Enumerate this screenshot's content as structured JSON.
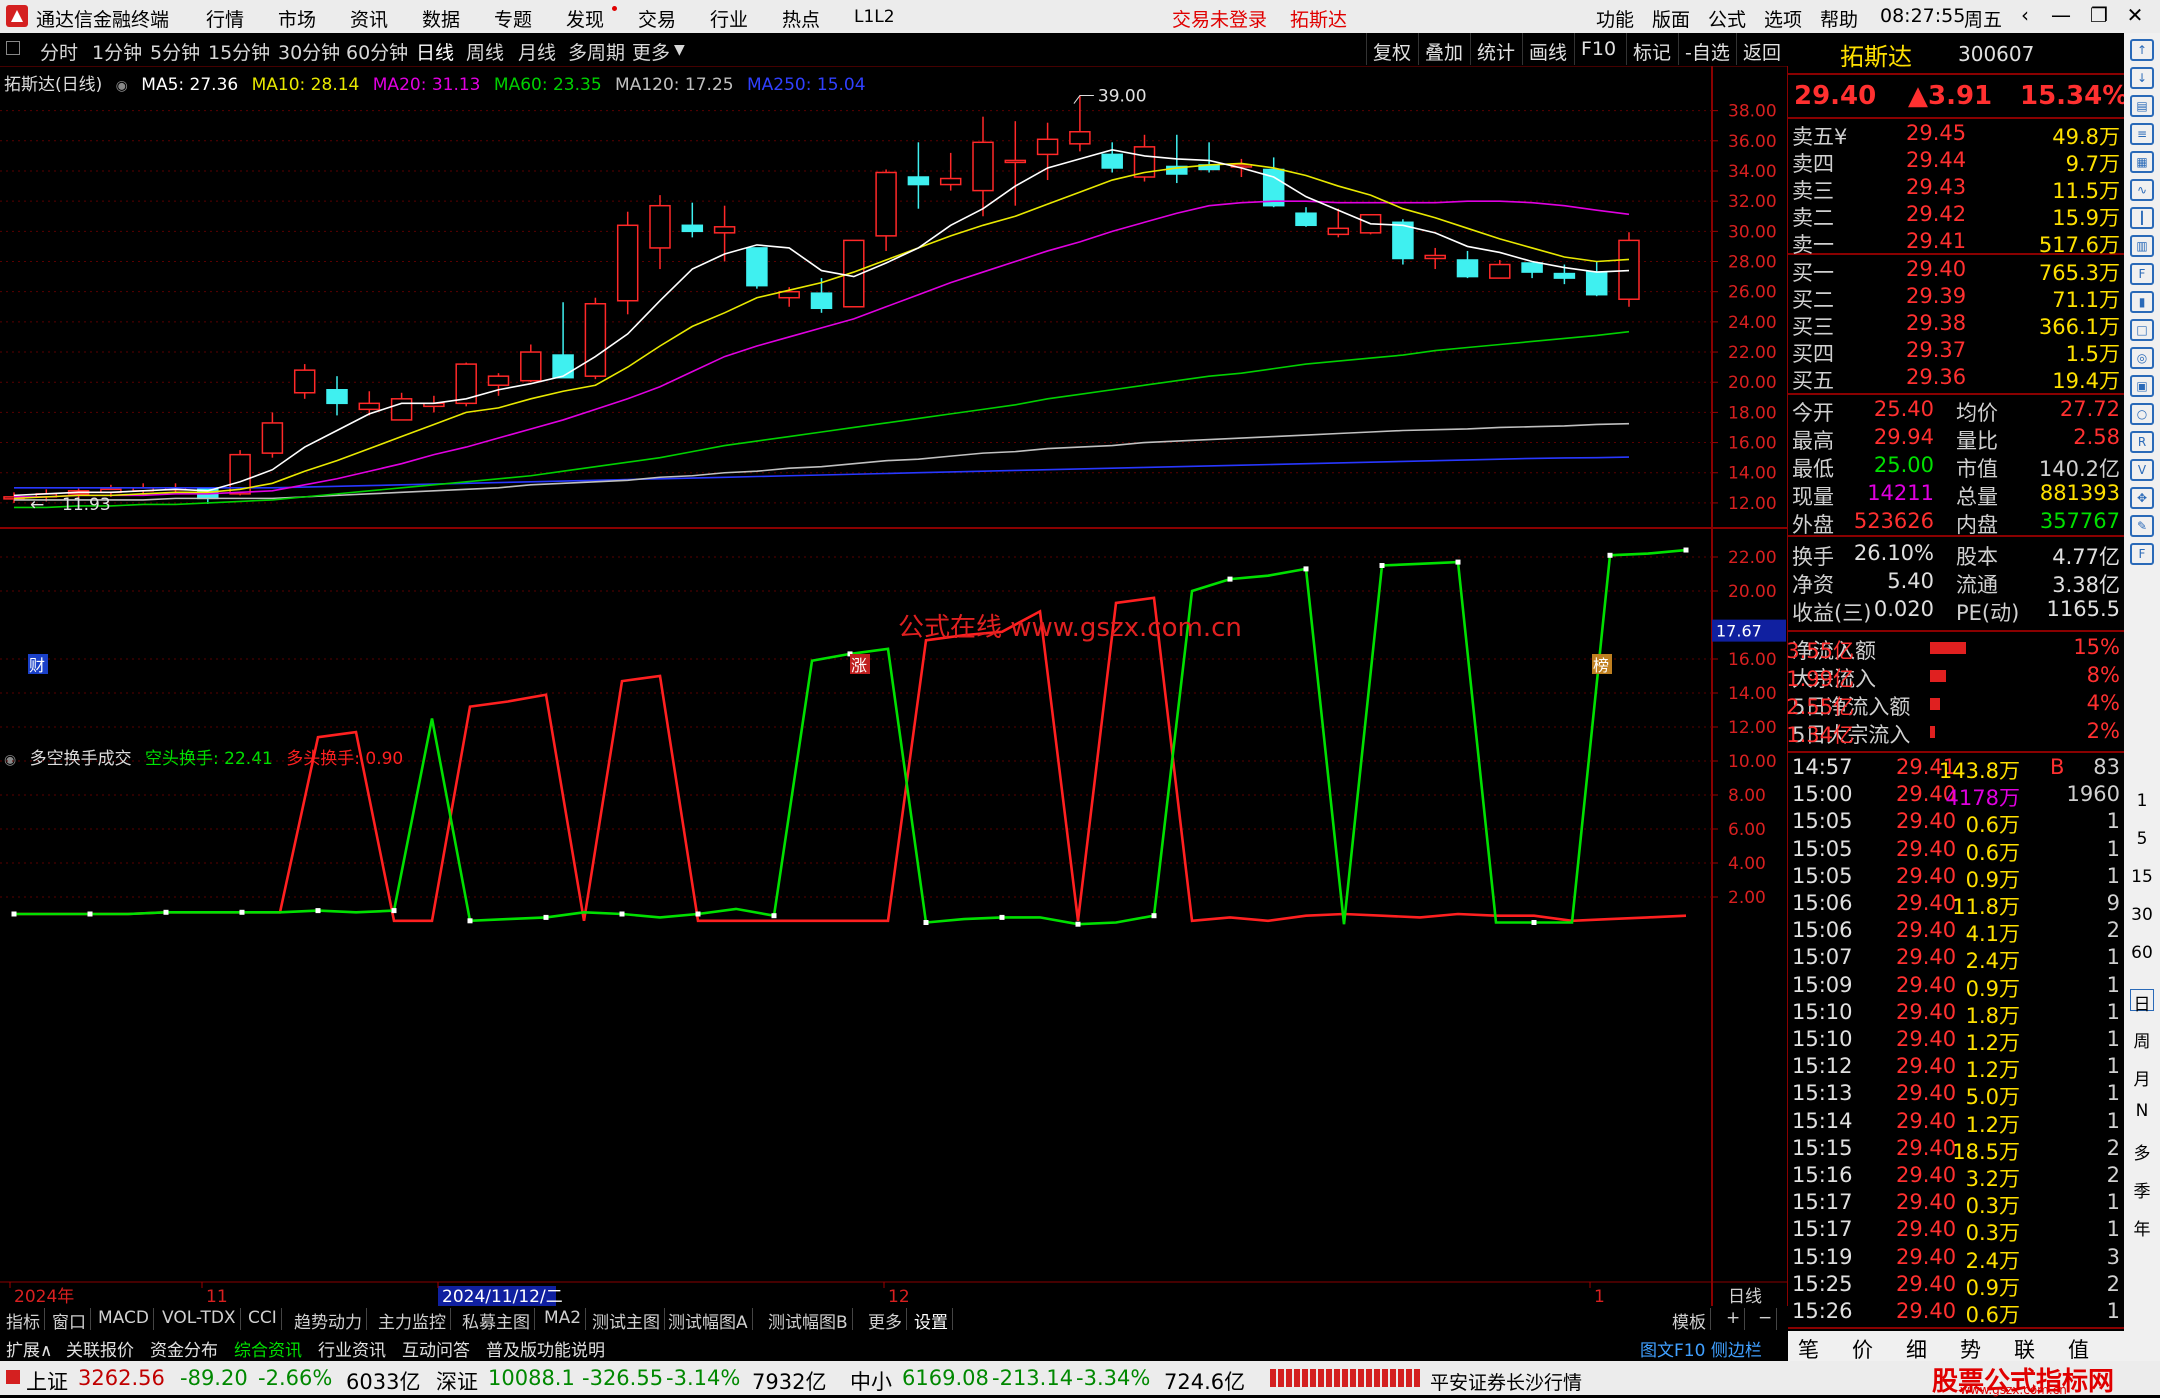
{
  "app": {
    "title": "通达信金融终端",
    "menus": [
      "行情",
      "市场",
      "资讯",
      "数据",
      "专题",
      "发现",
      "交易",
      "行业",
      "热点",
      "L1L2"
    ],
    "notice": "交易未登录",
    "stock_tag": "拓斯达",
    "right_menus": [
      "功能",
      "版面",
      "公式",
      "选项",
      "帮助"
    ],
    "time": "08:27:55",
    "weekday": "周五",
    "win_controls": [
      "‹",
      "—",
      "❐",
      "✕"
    ]
  },
  "toolbar": {
    "periods": [
      "分时",
      "1分钟",
      "5分钟",
      "15分钟",
      "30分钟",
      "60分钟",
      "日线",
      "周线",
      "月线",
      "多周期",
      "更多"
    ],
    "active": "日线",
    "buttons": [
      "复权",
      "叠加",
      "统计",
      "画线",
      "F10",
      "标记",
      "-自选",
      "返回"
    ]
  },
  "main_chart": {
    "title": "拓斯达(日线)",
    "ma_legend": [
      {
        "label": "MA5: 27.36",
        "color": "#ffffff"
      },
      {
        "label": "MA10: 28.14",
        "color": "#e8e800"
      },
      {
        "label": "MA20: 31.13",
        "color": "#e000e0"
      },
      {
        "label": "MA60: 23.35",
        "color": "#00d000"
      },
      {
        "label": "MA120: 17.25",
        "color": "#c0c0c0"
      },
      {
        "label": "MA250: 15.04",
        "color": "#3040ff"
      }
    ],
    "yticks": [
      "38.00",
      "36.00",
      "34.00",
      "32.00",
      "30.00",
      "28.00",
      "26.00",
      "24.00",
      "22.00",
      "20.00",
      "18.00",
      "16.00",
      "14.00",
      "12.00"
    ],
    "high_marker": "39.00",
    "low_marker": "11.93",
    "watermark": "公式在线 www.gszx.com.cn",
    "event_marks": [
      "财",
      "涨",
      "榜"
    ]
  },
  "sub_chart": {
    "title": "多空换手成交",
    "line1_label": "空头换手: 22.41",
    "line2_label": "多头换手: 0.90",
    "yticks": [
      "22.00",
      "20.00",
      "16.00",
      "14.00",
      "12.00",
      "10.00",
      "8.00",
      "6.00",
      "4.00",
      "2.00"
    ],
    "cursor_value": "17.67"
  },
  "x_axis": {
    "labels": [
      "2024年",
      "11",
      "2024/11/12/二",
      "12",
      "1"
    ],
    "mode": "日线"
  },
  "bottom_tabs": [
    "指标",
    "窗口",
    "MACD",
    "VOL-TDX",
    "CCI",
    "趋势动力",
    "主力监控",
    "私募主图",
    "MA2",
    "测试主图",
    "测试幅图A",
    "测试幅图B",
    "更多",
    "设置"
  ],
  "bottom_right": [
    "模板",
    "+",
    "−"
  ],
  "func_bar": [
    "扩展∧",
    "关联报价",
    "资金分布",
    "综合资讯",
    "行业资讯",
    "互动问答",
    "普及版功能说明"
  ],
  "func_bar_right": "图文F10  侧边栏 《",
  "status_bar": {
    "index1": {
      "name": "上证",
      "value": "3262.56",
      "chg": "-89.20",
      "pct": "-2.66%",
      "amt": "6033亿"
    },
    "index2": {
      "name": "深证",
      "value": "10088.1",
      "chg": "-326.55",
      "pct": "-3.14%",
      "amt": "7932亿"
    },
    "index3": {
      "name": "中小",
      "value": "6169.08",
      "chg": "-213.14",
      "pct": "-3.34%",
      "amt": "724.6亿"
    },
    "broker": "平安证券长沙行情",
    "brand": "股票公式指标网",
    "brand_url": "www.gszx.com.cn"
  },
  "quote": {
    "name": "拓斯达",
    "code": "300607",
    "price": "29.40",
    "chg": "▲3.91",
    "pct": "15.34%",
    "asks": [
      {
        "label": "卖五¥",
        "price": "29.45",
        "vol": "49.8万"
      },
      {
        "label": "卖四",
        "price": "29.44",
        "vol": "9.7万"
      },
      {
        "label": "卖三",
        "price": "29.43",
        "vol": "11.5万"
      },
      {
        "label": "卖二",
        "price": "29.42",
        "vol": "15.9万"
      },
      {
        "label": "卖一",
        "price": "29.41",
        "vol": "517.6万"
      }
    ],
    "bids": [
      {
        "label": "买一",
        "price": "29.40",
        "vol": "765.3万"
      },
      {
        "label": "买二",
        "price": "29.39",
        "vol": "71.1万"
      },
      {
        "label": "买三",
        "price": "29.38",
        "vol": "366.1万"
      },
      {
        "label": "买四",
        "price": "29.37",
        "vol": "1.5万"
      },
      {
        "label": "买五",
        "price": "29.36",
        "vol": "19.4万"
      }
    ],
    "stats": [
      {
        "l1": "今开",
        "v1": "25.40",
        "l2": "均价",
        "v2": "27.72"
      },
      {
        "l1": "最高",
        "v1": "29.94",
        "l2": "量比",
        "v2": "2.58"
      },
      {
        "l1": "最低",
        "v1": "25.00",
        "l2": "市值",
        "v2": "140.2亿"
      },
      {
        "l1": "现量",
        "v1": "14211",
        "l2": "总量",
        "v2": "881393"
      },
      {
        "l1": "外盘",
        "v1": "523626",
        "l2": "内盘",
        "v2": "357767"
      }
    ],
    "fin": [
      {
        "l1": "换手",
        "v1": "26.10%",
        "l2": "股本",
        "v2": "4.77亿"
      },
      {
        "l1": "净资",
        "v1": "5.40",
        "l2": "流通",
        "v2": "3.38亿"
      },
      {
        "l1": "收益(三)",
        "v1": "0.020",
        "l2": "PE(动)",
        "v2": "1165.5"
      }
    ],
    "flows": [
      {
        "label": "净流入额",
        "value": "3.55亿",
        "pct": "15%",
        "bar": 0.9
      },
      {
        "label": "大宗流入",
        "value": "1.99亿",
        "pct": "8%",
        "bar": 0.4
      },
      {
        "label": "5日净流入额",
        "value": "2.55亿",
        "pct": "4%",
        "bar": 0.25
      },
      {
        "label": "5日大宗流入",
        "value": "1.34亿",
        "pct": "2%",
        "bar": 0.12
      }
    ],
    "ticks": [
      {
        "t": "14:57",
        "p": "29.41",
        "v": "143.8万",
        "f": "B",
        "n": "83"
      },
      {
        "t": "15:00",
        "p": "29.40",
        "v": "4178万",
        "f": "",
        "n": "1960"
      },
      {
        "t": "15:05",
        "p": "29.40",
        "v": "0.6万",
        "f": "",
        "n": "1"
      },
      {
        "t": "15:05",
        "p": "29.40",
        "v": "0.6万",
        "f": "",
        "n": "1"
      },
      {
        "t": "15:05",
        "p": "29.40",
        "v": "0.9万",
        "f": "",
        "n": "1"
      },
      {
        "t": "15:06",
        "p": "29.40",
        "v": "11.8万",
        "f": "",
        "n": "9"
      },
      {
        "t": "15:06",
        "p": "29.40",
        "v": "4.1万",
        "f": "",
        "n": "2"
      },
      {
        "t": "15:07",
        "p": "29.40",
        "v": "2.4万",
        "f": "",
        "n": "1"
      },
      {
        "t": "15:09",
        "p": "29.40",
        "v": "0.9万",
        "f": "",
        "n": "1"
      },
      {
        "t": "15:10",
        "p": "29.40",
        "v": "1.8万",
        "f": "",
        "n": "1"
      },
      {
        "t": "15:10",
        "p": "29.40",
        "v": "1.2万",
        "f": "",
        "n": "1"
      },
      {
        "t": "15:12",
        "p": "29.40",
        "v": "1.2万",
        "f": "",
        "n": "1"
      },
      {
        "t": "15:13",
        "p": "29.40",
        "v": "5.0万",
        "f": "",
        "n": "1"
      },
      {
        "t": "15:14",
        "p": "29.40",
        "v": "1.2万",
        "f": "",
        "n": "1"
      },
      {
        "t": "15:15",
        "p": "29.40",
        "v": "18.5万",
        "f": "",
        "n": "2"
      },
      {
        "t": "15:16",
        "p": "29.40",
        "v": "3.2万",
        "f": "",
        "n": "2"
      },
      {
        "t": "15:17",
        "p": "29.40",
        "v": "0.3万",
        "f": "",
        "n": "1"
      },
      {
        "t": "15:17",
        "p": "29.40",
        "v": "0.3万",
        "f": "",
        "n": "1"
      },
      {
        "t": "15:19",
        "p": "29.40",
        "v": "2.4万",
        "f": "",
        "n": "3"
      },
      {
        "t": "15:25",
        "p": "29.40",
        "v": "0.9万",
        "f": "",
        "n": "2"
      },
      {
        "t": "15:26",
        "p": "29.40",
        "v": "0.6万",
        "f": "",
        "n": "1"
      }
    ],
    "tabs": [
      "笔",
      "价",
      "细",
      "势",
      "联",
      "值"
    ]
  },
  "sidebar": {
    "text_items": [
      "1",
      "5",
      "15",
      "30",
      "60",
      "日",
      "周",
      "月",
      "N",
      "多",
      "季",
      "年"
    ],
    "icons": [
      "arrow-up-icon",
      "arrow-down-icon",
      "chart-icon",
      "list-icon",
      "grid-icon",
      "line-icon",
      "candle-icon",
      "table-icon",
      "f10-icon",
      "bar-icon",
      "book-icon",
      "compass-icon",
      "chip-icon",
      "circle-icon",
      "rsi-icon",
      "vol-icon",
      "move-icon",
      "pen-icon",
      "fs-icon"
    ]
  },
  "chart_data": {
    "type": "candlestick",
    "candles": [
      {
        "o": 12.3,
        "h": 12.7,
        "l": 12.0,
        "c": 12.4
      },
      {
        "o": 12.4,
        "h": 12.9,
        "l": 12.1,
        "c": 12.6
      },
      {
        "o": 12.6,
        "h": 13.0,
        "l": 12.3,
        "c": 12.8
      },
      {
        "o": 12.7,
        "h": 13.2,
        "l": 12.4,
        "c": 12.9
      },
      {
        "o": 12.8,
        "h": 13.3,
        "l": 12.5,
        "c": 13.0
      },
      {
        "o": 12.9,
        "h": 13.3,
        "l": 12.6,
        "c": 13.0
      },
      {
        "o": 13.0,
        "h": 13.0,
        "l": 11.93,
        "c": 12.3
      },
      {
        "o": 12.6,
        "h": 15.5,
        "l": 12.5,
        "c": 15.2
      },
      {
        "o": 15.3,
        "h": 18.0,
        "l": 15.0,
        "c": 17.3
      },
      {
        "o": 19.3,
        "h": 21.2,
        "l": 18.9,
        "c": 20.8
      },
      {
        "o": 19.5,
        "h": 20.4,
        "l": 17.8,
        "c": 18.6
      },
      {
        "o": 18.2,
        "h": 19.4,
        "l": 17.8,
        "c": 18.6
      },
      {
        "o": 17.5,
        "h": 19.3,
        "l": 17.5,
        "c": 18.9
      },
      {
        "o": 18.4,
        "h": 19.1,
        "l": 18.0,
        "c": 18.6
      },
      {
        "o": 18.6,
        "h": 21.3,
        "l": 18.4,
        "c": 21.2
      },
      {
        "o": 19.8,
        "h": 20.6,
        "l": 19.1,
        "c": 20.4
      },
      {
        "o": 20.1,
        "h": 22.5,
        "l": 20.0,
        "c": 22.0
      },
      {
        "o": 21.8,
        "h": 25.3,
        "l": 20.3,
        "c": 20.3
      },
      {
        "o": 20.4,
        "h": 25.6,
        "l": 20.2,
        "c": 25.2
      },
      {
        "o": 25.4,
        "h": 31.3,
        "l": 24.5,
        "c": 30.4
      },
      {
        "o": 28.9,
        "h": 32.4,
        "l": 27.5,
        "c": 31.7
      },
      {
        "o": 30.4,
        "h": 31.9,
        "l": 29.6,
        "c": 30.0
      },
      {
        "o": 29.9,
        "h": 31.7,
        "l": 28.0,
        "c": 30.3
      },
      {
        "o": 28.9,
        "h": 28.9,
        "l": 26.2,
        "c": 26.4
      },
      {
        "o": 25.6,
        "h": 26.3,
        "l": 25.0,
        "c": 26.0
      },
      {
        "o": 25.9,
        "h": 26.9,
        "l": 24.6,
        "c": 24.9
      },
      {
        "o": 25.0,
        "h": 26.2,
        "l": 25.0,
        "c": 29.4
      },
      {
        "o": 29.7,
        "h": 34.1,
        "l": 28.7,
        "c": 33.9
      },
      {
        "o": 33.6,
        "h": 35.9,
        "l": 31.5,
        "c": 33.1
      },
      {
        "o": 33.1,
        "h": 35.2,
        "l": 32.7,
        "c": 33.5
      },
      {
        "o": 32.7,
        "h": 37.6,
        "l": 31.0,
        "c": 35.9
      },
      {
        "o": 34.6,
        "h": 37.3,
        "l": 31.7,
        "c": 34.7
      },
      {
        "o": 35.1,
        "h": 37.2,
        "l": 33.4,
        "c": 36.1
      },
      {
        "o": 35.8,
        "h": 39.0,
        "l": 35.3,
        "c": 36.6
      },
      {
        "o": 35.1,
        "h": 35.9,
        "l": 33.9,
        "c": 34.2
      },
      {
        "o": 33.6,
        "h": 36.4,
        "l": 33.3,
        "c": 35.6
      },
      {
        "o": 34.3,
        "h": 36.4,
        "l": 33.2,
        "c": 33.8
      },
      {
        "o": 34.4,
        "h": 35.9,
        "l": 33.9,
        "c": 34.1
      },
      {
        "o": 34.4,
        "h": 34.8,
        "l": 33.6,
        "c": 34.4
      },
      {
        "o": 34.1,
        "h": 34.9,
        "l": 31.6,
        "c": 31.7
      },
      {
        "o": 31.2,
        "h": 31.6,
        "l": 30.3,
        "c": 30.4
      },
      {
        "o": 29.8,
        "h": 31.5,
        "l": 29.6,
        "c": 30.2
      },
      {
        "o": 29.9,
        "h": 31.1,
        "l": 29.8,
        "c": 31.1
      },
      {
        "o": 30.6,
        "h": 30.8,
        "l": 27.8,
        "c": 28.2
      },
      {
        "o": 28.2,
        "h": 28.9,
        "l": 27.5,
        "c": 28.4
      },
      {
        "o": 28.1,
        "h": 28.7,
        "l": 26.9,
        "c": 27.0
      },
      {
        "o": 26.9,
        "h": 28.1,
        "l": 26.9,
        "c": 27.8
      },
      {
        "o": 27.9,
        "h": 27.9,
        "l": 26.9,
        "c": 27.3
      },
      {
        "o": 27.2,
        "h": 27.8,
        "l": 26.5,
        "c": 26.9
      },
      {
        "o": 27.3,
        "h": 28.0,
        "l": 25.7,
        "c": 25.8
      },
      {
        "o": 25.5,
        "h": 29.94,
        "l": 25.0,
        "c": 29.4
      }
    ],
    "ma5": [
      12.5,
      12.6,
      12.7,
      12.7,
      12.8,
      12.9,
      12.8,
      13.4,
      14.2,
      15.7,
      16.8,
      17.9,
      18.6,
      18.6,
      18.9,
      19.5,
      19.9,
      20.4,
      21.7,
      23.2,
      25.4,
      27.5,
      28.5,
      29.1,
      28.9,
      27.4,
      27.0,
      27.9,
      28.9,
      30.4,
      31.5,
      33.0,
      34.2,
      34.8,
      35.4,
      35.0,
      34.8,
      34.7,
      34.2,
      33.6,
      32.3,
      31.4,
      30.5,
      30.4,
      29.9,
      29.0,
      28.6,
      28.0,
      27.6,
      27.3,
      27.4
    ],
    "ma10": [
      12.3,
      12.4,
      12.5,
      12.5,
      12.6,
      12.7,
      12.7,
      12.9,
      13.3,
      14.1,
      14.8,
      15.6,
      16.4,
      17.2,
      18.0,
      18.3,
      18.9,
      19.4,
      19.8,
      21.0,
      22.4,
      23.7,
      24.6,
      25.6,
      26.1,
      26.6,
      27.3,
      28.1,
      28.9,
      29.7,
      30.4,
      31.0,
      31.8,
      32.6,
      33.4,
      33.9,
      34.2,
      34.4,
      34.5,
      34.2,
      33.7,
      33.0,
      32.4,
      31.5,
      30.9,
      30.2,
      29.5,
      28.9,
      28.3,
      28.0,
      28.14
    ],
    "ma20": [
      12.4,
      12.4,
      12.5,
      12.5,
      12.5,
      12.6,
      12.6,
      12.7,
      12.8,
      13.2,
      13.6,
      14.1,
      14.6,
      15.2,
      15.7,
      16.3,
      16.9,
      17.5,
      18.2,
      18.9,
      19.7,
      20.7,
      21.7,
      22.4,
      23.0,
      23.6,
      24.2,
      25.0,
      25.8,
      26.6,
      27.3,
      28.0,
      28.7,
      29.3,
      30.0,
      30.6,
      31.2,
      31.7,
      31.9,
      32.0,
      32.0,
      31.9,
      31.9,
      31.9,
      31.9,
      32.0,
      32.0,
      31.9,
      31.7,
      31.4,
      31.13
    ],
    "ma60": [
      11.7,
      11.7,
      11.8,
      11.8,
      11.9,
      11.9,
      12.0,
      12.1,
      12.2,
      12.4,
      12.6,
      12.8,
      13.0,
      13.2,
      13.4,
      13.6,
      13.8,
      14.1,
      14.4,
      14.7,
      15.0,
      15.4,
      15.8,
      16.1,
      16.4,
      16.7,
      17.0,
      17.3,
      17.6,
      17.9,
      18.2,
      18.5,
      18.9,
      19.2,
      19.5,
      19.8,
      20.1,
      20.4,
      20.6,
      20.9,
      21.2,
      21.4,
      21.6,
      21.8,
      22.1,
      22.3,
      22.5,
      22.7,
      22.9,
      23.1,
      23.35
    ],
    "ma120": [
      12.2,
      12.2,
      12.2,
      12.2,
      12.2,
      12.3,
      12.3,
      12.3,
      12.3,
      12.4,
      12.5,
      12.6,
      12.7,
      12.8,
      12.9,
      13.0,
      13.2,
      13.3,
      13.4,
      13.5,
      13.7,
      13.8,
      14.0,
      14.1,
      14.3,
      14.4,
      14.6,
      14.8,
      14.9,
      15.1,
      15.3,
      15.4,
      15.6,
      15.7,
      15.8,
      16.0,
      16.1,
      16.2,
      16.3,
      16.4,
      16.5,
      16.6,
      16.7,
      16.8,
      16.85,
      16.9,
      17.0,
      17.05,
      17.1,
      17.2,
      17.25
    ],
    "ma250": [
      13.0,
      13.0,
      13.0,
      13.0,
      13.0,
      13.0,
      13.0,
      13.0,
      13.0,
      13.05,
      13.1,
      13.15,
      13.2,
      13.25,
      13.3,
      13.35,
      13.4,
      13.45,
      13.5,
      13.55,
      13.6,
      13.65,
      13.7,
      13.75,
      13.8,
      13.85,
      13.9,
      13.95,
      14.0,
      14.05,
      14.1,
      14.15,
      14.2,
      14.25,
      14.3,
      14.35,
      14.4,
      14.45,
      14.5,
      14.55,
      14.6,
      14.65,
      14.7,
      14.75,
      14.8,
      14.85,
      14.9,
      14.95,
      14.98,
      15.0,
      15.04
    ],
    "short_turnover": [
      1.0,
      1.0,
      1.0,
      1.0,
      1.1,
      1.1,
      1.1,
      1.1,
      1.2,
      1.1,
      1.2,
      12.5,
      0.6,
      0.7,
      0.8,
      1.1,
      1.0,
      0.8,
      1.0,
      1.3,
      0.9,
      15.9,
      16.3,
      16.6,
      0.5,
      0.7,
      0.8,
      0.8,
      0.4,
      0.5,
      0.9,
      20.0,
      20.7,
      20.9,
      21.3,
      0.4,
      21.5,
      21.6,
      21.7,
      0.5,
      0.5,
      0.5,
      22.1,
      22.2,
      22.41
    ],
    "long_turnover": [
      1.0,
      1.0,
      1.0,
      1.0,
      1.1,
      1.1,
      1.1,
      1.1,
      11.4,
      11.7,
      0.6,
      0.6,
      13.2,
      13.5,
      13.9,
      0.6,
      14.7,
      15.0,
      0.6,
      0.6,
      0.6,
      0.6,
      0.6,
      0.6,
      17.1,
      17.4,
      17.6,
      18.8,
      0.6,
      19.3,
      19.6,
      0.6,
      0.8,
      0.6,
      0.9,
      1.0,
      0.9,
      0.8,
      1.0,
      0.9,
      0.9,
      0.6,
      0.7,
      0.8,
      0.9
    ],
    "ylim_main": [
      11.0,
      39.5
    ],
    "ylim_sub": [
      0,
      23.0
    ]
  }
}
